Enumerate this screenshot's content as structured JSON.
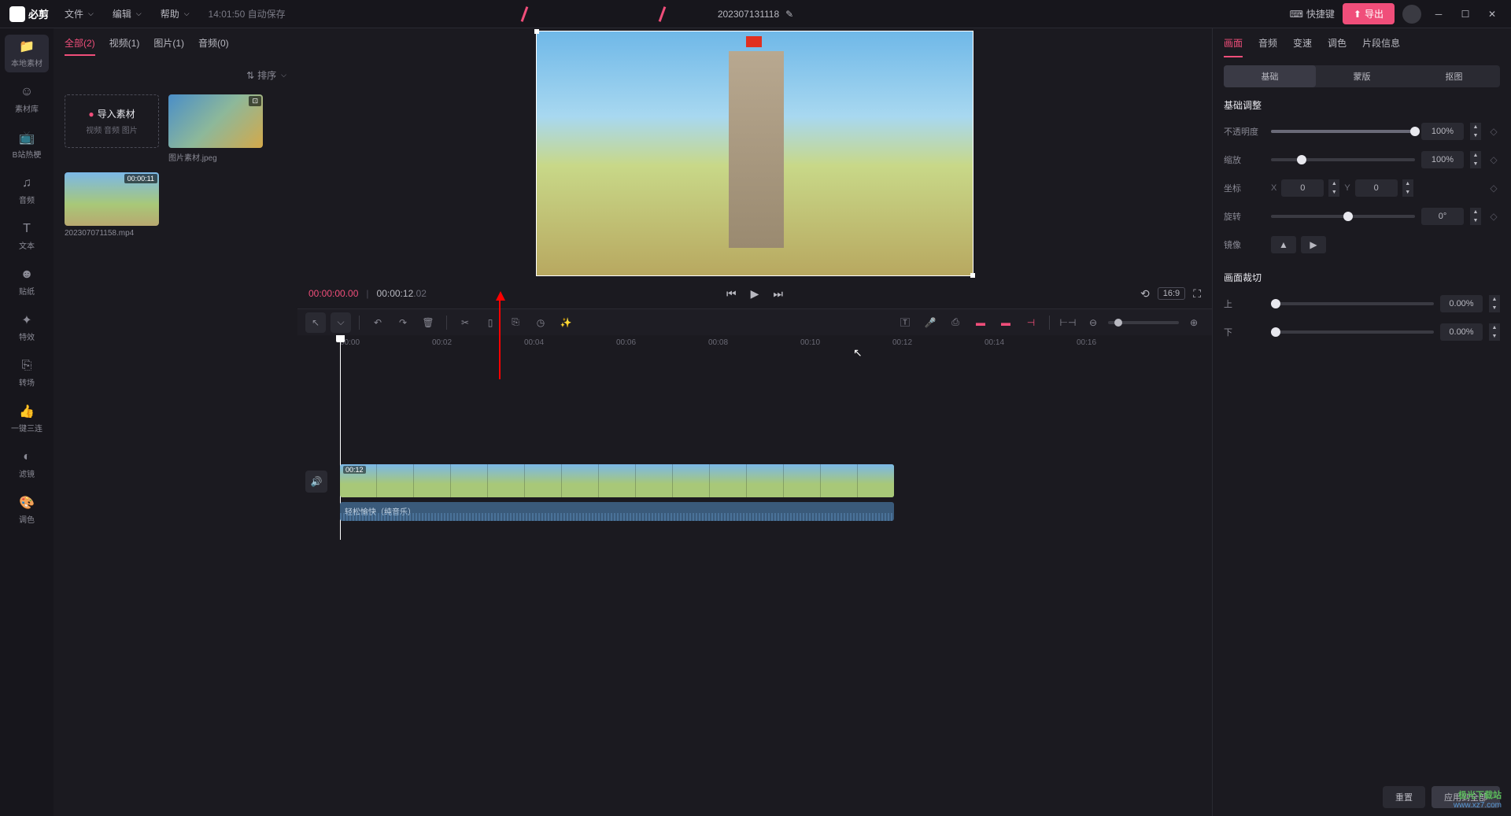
{
  "app": {
    "name": "必剪"
  },
  "menus": {
    "file": "文件",
    "edit": "编辑",
    "help": "帮助"
  },
  "autosave": "14:01:50 自动保存",
  "project": {
    "name": "202307131118"
  },
  "titlebar": {
    "shortcut": "快捷键",
    "export": "导出"
  },
  "sidebar": [
    {
      "id": "local",
      "label": "本地素材"
    },
    {
      "id": "lib",
      "label": "素材库"
    },
    {
      "id": "hot",
      "label": "B站热梗"
    },
    {
      "id": "audio",
      "label": "音频"
    },
    {
      "id": "text",
      "label": "文本"
    },
    {
      "id": "sticker",
      "label": "贴纸"
    },
    {
      "id": "effect",
      "label": "特效"
    },
    {
      "id": "transition",
      "label": "转场"
    },
    {
      "id": "combo",
      "label": "一键三连"
    },
    {
      "id": "filter",
      "label": "滤镜"
    },
    {
      "id": "color",
      "label": "调色"
    }
  ],
  "mediaTabs": {
    "all": "全部(2)",
    "video": "视频(1)",
    "image": "图片(1)",
    "audio": "音频(0)"
  },
  "sort": "排序",
  "import": {
    "title": "导入素材",
    "sub": "视频 音频 图片"
  },
  "media": [
    {
      "name": "图片素材.jpeg",
      "badge": ""
    },
    {
      "name": "202307071158.mp4",
      "badge": "00:00:11"
    }
  ],
  "player": {
    "current": "00:00:00.00",
    "duration": "00:00:12",
    "durFrac": ".02",
    "ratio": "16:9"
  },
  "ruler": [
    "00:00",
    "00:02",
    "00:04",
    "00:06",
    "00:08",
    "00:10",
    "00:12",
    "00:14",
    "00:16"
  ],
  "clip": {
    "duration": "00:12"
  },
  "audioClip": {
    "name": "轻松愉快（纯音乐）"
  },
  "inspector": {
    "tabs": {
      "picture": "画面",
      "audio": "音频",
      "speed": "变速",
      "color": "调色",
      "info": "片段信息"
    },
    "subtabs": {
      "basic": "基础",
      "mask": "蒙版",
      "cutout": "抠图"
    },
    "section_basic": "基础调整",
    "opacity": {
      "label": "不透明度",
      "value": "100%"
    },
    "scale": {
      "label": "缩放",
      "value": "100%"
    },
    "position": {
      "label": "坐标",
      "xLabel": "X",
      "x": "0",
      "yLabel": "Y",
      "y": "0"
    },
    "rotation": {
      "label": "旋转",
      "value": "0°"
    },
    "mirror": {
      "label": "镜像"
    },
    "section_crop": "画面裁切",
    "cropTop": {
      "label": "上",
      "value": "0.00%"
    },
    "cropBottom": {
      "label": "下",
      "value": "0.00%"
    },
    "footer": {
      "reset": "重置",
      "applyAll": "应用到全部"
    }
  },
  "watermark": {
    "line1": "极光下载站",
    "line2": "www.xz7.com"
  }
}
